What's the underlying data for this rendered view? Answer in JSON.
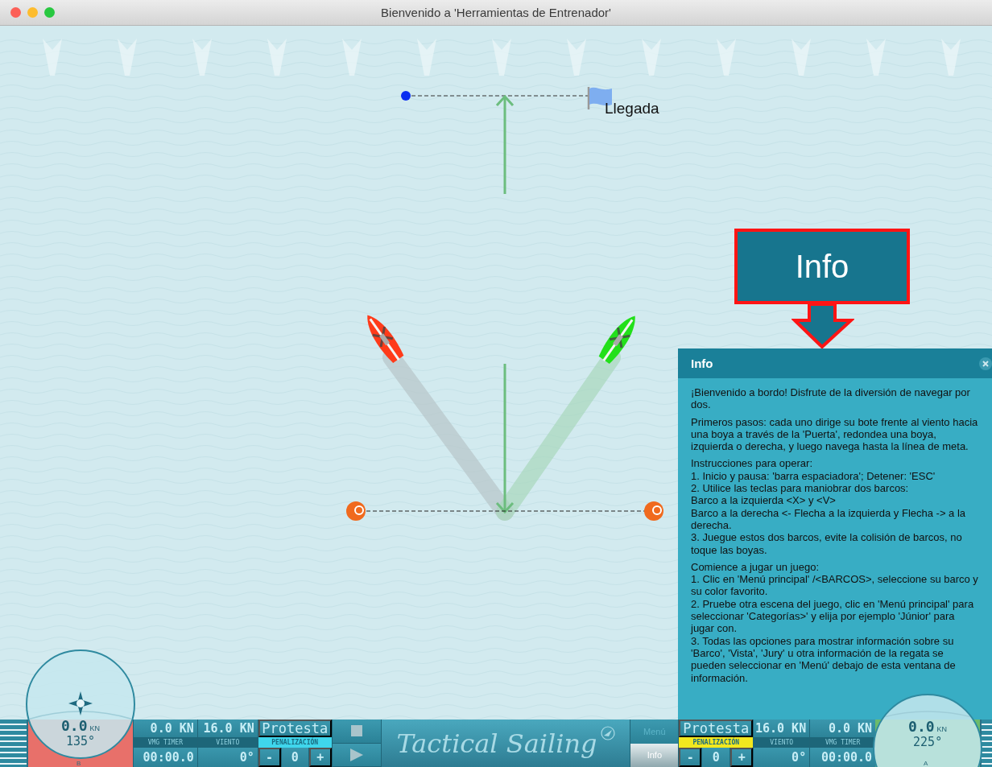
{
  "window": {
    "title": "Bienvenido a 'Herramientas de Entrenador'"
  },
  "course": {
    "finish_label": "Llegada"
  },
  "boats": [
    {
      "color": "#ff3b1a"
    },
    {
      "color": "#22e01a"
    }
  ],
  "callout": {
    "label": "Info"
  },
  "info_panel": {
    "title": "Info",
    "paragraphs": [
      [
        "¡Bienvenido a bordo! Disfrute de la diversión de navegar por dos."
      ],
      [
        "Primeros pasos: cada uno dirige su bote frente al viento hacia una boya a través de la 'Puerta', redondea una boya, izquierda o derecha, y luego navega hasta la línea de meta."
      ],
      [
        "Instrucciones para operar:",
        "1. Inicio y pausa: 'barra espaciadora'; Detener: 'ESC'",
        "2. Utilice las teclas para maniobrar dos barcos:",
        "Barco a la izquierda <X> y <V>",
        "Barco a la derecha <- Flecha a la izquierda y Flecha -> a la derecha.",
        "3. Juegue estos dos barcos, evite la colisión de barcos, no toque las boyas."
      ],
      [
        "Comience a jugar un juego:",
        "1. Clic en 'Menú principal' /<BARCOS>, seleccione su barco y su color favorito.",
        "2. Pruebe otra escena del juego, clic en 'Menú principal' para seleccionar 'Categorías>' y elija por ejemplo 'Júnior' para jugar con.",
        "3. Todas las opciones para mostrar información sobre su 'Barco', 'Vista', 'Jury' u otra información de la regata se pueden seleccionar en 'Menú' debajo de esta ventana de información."
      ]
    ]
  },
  "players": [
    {
      "kind": "left",
      "color": "#e8706a",
      "sun_marker": true,
      "speed": "0.0",
      "speed_unit": "KN",
      "heading": "135°",
      "letter": "B",
      "vmg": "0.0 KN",
      "vmg_label": "VMG TIMER",
      "timer": "00:00.0",
      "wind": "16.0 KN",
      "wind_label": "VIENTO",
      "wind_angle": "0°",
      "protest": "Protesta",
      "penalty": {
        "label": "PENALIZACIÓN",
        "color": "#3fd6ec"
      },
      "minus": "-",
      "penalties": "0",
      "plus": "+"
    },
    {
      "kind": "right",
      "color": "#6cbb6a",
      "sun_marker": false,
      "speed": "0.0",
      "speed_unit": "KN",
      "heading": "225°",
      "letter": "A",
      "vmg": "0.0 KN",
      "vmg_label": "VMG TIMER",
      "timer": "00:00.0",
      "wind": "16.0 KN",
      "wind_label": "VIENTO",
      "wind_angle": "0°",
      "protest": "Protesta",
      "penalty": {
        "label": "PENALIZACIÓN",
        "color": "#f2e81e"
      },
      "minus": "-",
      "penalties": "0",
      "plus": "+"
    }
  ],
  "logo": {
    "text": "Tactical Sailing"
  },
  "menu_tabs": [
    {
      "label": "Menú",
      "selected": false
    },
    {
      "label": "Info",
      "selected": true
    }
  ]
}
